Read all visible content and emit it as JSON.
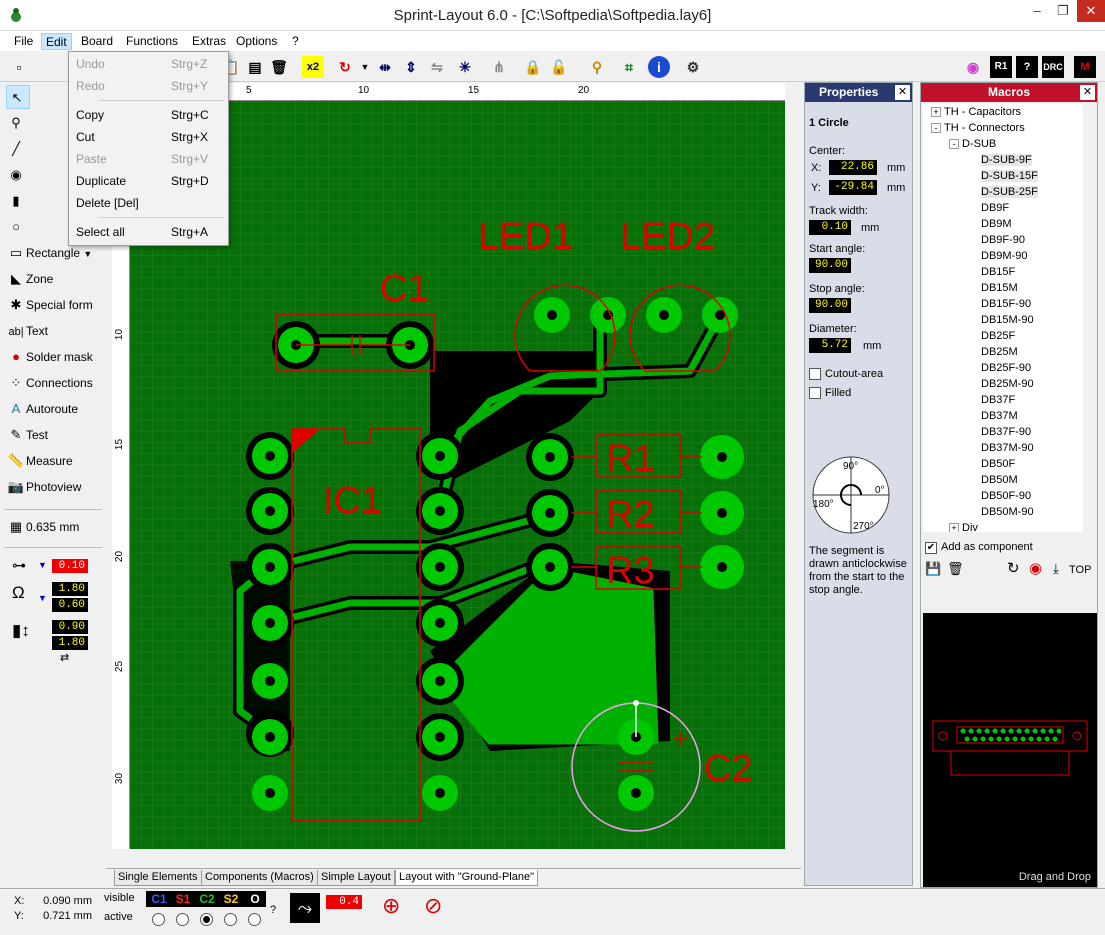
{
  "window": {
    "title": "Sprint-Layout 6.0 - [C:\\Softpedia\\Softpedia.lay6]"
  },
  "menubar": [
    "File",
    "Edit",
    "Board",
    "Functions",
    "Extras",
    "Options",
    "?"
  ],
  "edit_menu": [
    {
      "label": "Undo",
      "shortcut": "Strg+Z",
      "disabled": true
    },
    {
      "label": "Redo",
      "shortcut": "Strg+Y",
      "disabled": true
    },
    {
      "label": "Copy",
      "shortcut": "Strg+C",
      "disabled": false
    },
    {
      "label": "Cut",
      "shortcut": "Strg+X",
      "disabled": false
    },
    {
      "label": "Paste",
      "shortcut": "Strg+V",
      "disabled": true
    },
    {
      "label": "Duplicate",
      "shortcut": "Strg+D",
      "disabled": false
    },
    {
      "label": "Delete [Del]",
      "shortcut": "",
      "disabled": false
    },
    {
      "label": "Select all",
      "shortcut": "Strg+A",
      "disabled": false
    }
  ],
  "tools": [
    "Rectangle",
    "Zone",
    "Special form",
    "Text",
    "Solder mask",
    "Connections",
    "Autoroute",
    "Test",
    "Measure",
    "Photoview"
  ],
  "grid_size": "0.635 mm",
  "left_values": {
    "track": "0.10",
    "pad1": "1.80",
    "pad2": "0.60",
    "smd1": "0.90",
    "smd2": "1.80"
  },
  "ruler_top": [
    "5",
    "10",
    "15",
    "20"
  ],
  "ruler_left": [
    "10",
    "15",
    "20",
    "25",
    "30"
  ],
  "pcb_labels": {
    "led1": "LED1",
    "led2": "LED2",
    "c1": "C1",
    "ic1": "IC1",
    "r1": "R1",
    "r2": "R2",
    "r3": "R3",
    "c2": "C2"
  },
  "tabs": [
    "Single Elements",
    "Components (Macros)",
    "Simple Layout",
    "Layout with \"Ground-Plane\""
  ],
  "properties": {
    "header": "Properties",
    "object": "1 Circle",
    "center_label": "Center:",
    "x_label": "X:",
    "x": "22.86",
    "y_label": "Y:",
    "y": "-29.84",
    "unit": "mm",
    "track_width_label": "Track width:",
    "track_width": "0.10",
    "start_angle_label": "Start angle:",
    "start_angle": "90.00",
    "stop_angle_label": "Stop angle:",
    "stop_angle": "90.00",
    "diameter_label": "Diameter:",
    "diameter": "5.72",
    "cutout_label": "Cutout-area",
    "filled_label": "Filled",
    "angle_90": "90°",
    "angle_0": "0°",
    "angle_180": "180°",
    "angle_270": "270°",
    "note": "The segment is drawn anticlockwise from the start to the stop angle."
  },
  "macros": {
    "header": "Macros",
    "tree": [
      {
        "label": "TH - Capacitors",
        "level": 0,
        "sign": "+"
      },
      {
        "label": "TH - Connectors",
        "level": 0,
        "sign": "-"
      },
      {
        "label": "D-SUB",
        "level": 1,
        "sign": "-"
      },
      {
        "label": "D-SUB-9F",
        "level": 2
      },
      {
        "label": "D-SUB-15F",
        "level": 2
      },
      {
        "label": "D-SUB-25F",
        "level": 2
      },
      {
        "label": "DB9F",
        "level": 2
      },
      {
        "label": "DB9M",
        "level": 2
      },
      {
        "label": "DB9F-90",
        "level": 2
      },
      {
        "label": "DB9M-90",
        "level": 2
      },
      {
        "label": "DB15F",
        "level": 2
      },
      {
        "label": "DB15M",
        "level": 2
      },
      {
        "label": "DB15F-90",
        "level": 2
      },
      {
        "label": "DB15M-90",
        "level": 2
      },
      {
        "label": "DB25F",
        "level": 2
      },
      {
        "label": "DB25M",
        "level": 2
      },
      {
        "label": "DB25F-90",
        "level": 2
      },
      {
        "label": "DB25M-90",
        "level": 2
      },
      {
        "label": "DB37F",
        "level": 2
      },
      {
        "label": "DB37M",
        "level": 2
      },
      {
        "label": "DB37F-90",
        "level": 2
      },
      {
        "label": "DB37M-90",
        "level": 2
      },
      {
        "label": "DB50F",
        "level": 2
      },
      {
        "label": "DB50M",
        "level": 2
      },
      {
        "label": "DB50F-90",
        "level": 2
      },
      {
        "label": "DB50M-90",
        "level": 2
      },
      {
        "label": "Div",
        "level": 1,
        "sign": "+"
      }
    ],
    "add_component_label": "Add as component",
    "top_label": "TOP",
    "drag_drop": "Drag and Drop"
  },
  "status": {
    "x_label": "X:",
    "x": "0.090 mm",
    "y_label": "Y:",
    "y": "0.721 mm",
    "visible": "visible",
    "active": "active",
    "layers": [
      "C1",
      "S1",
      "C2",
      "S2",
      "O"
    ],
    "layer_colors": [
      "#3060ff",
      "#ff2020",
      "#20c020",
      "#ffd000",
      "#ffffff"
    ],
    "help": "?",
    "track_value": "0.4"
  }
}
